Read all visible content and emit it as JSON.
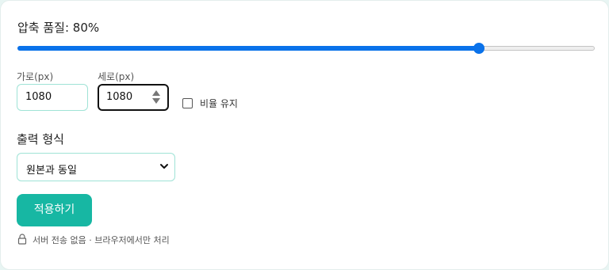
{
  "quality": {
    "label": "압축 품질: 80%",
    "value_percent": 80
  },
  "dimensions": {
    "width_label": "가로(px)",
    "width_value": "1080",
    "height_label": "세로(px)",
    "height_value": "1080",
    "keep_ratio_label": "비율 유지",
    "keep_ratio_checked": false
  },
  "format": {
    "label": "출력 형식",
    "selected": "원본과 동일"
  },
  "apply_button_label": "적용하기",
  "privacy_note": "서버 전송 없음 · 브라우저에서만 처리",
  "colors": {
    "accent": "#17b7a3",
    "slider": "#0a72ea",
    "input_border": "#9fe3d6"
  },
  "icons": {
    "lock": "lock-icon",
    "chevron": "chevron-down-icon",
    "spin": "spin-arrows-icon"
  }
}
